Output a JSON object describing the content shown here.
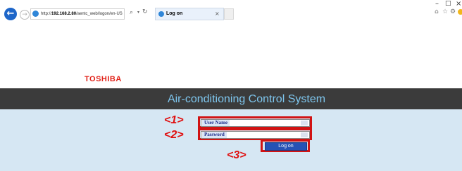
{
  "browser": {
    "url_prefix": "http://",
    "url_host": "192.168.2.80",
    "url_path": "/aentc_web/logon/en-US",
    "tab_title": "Log on",
    "tab_close": "×",
    "back_glyph": "←",
    "forward_glyph": "→",
    "window_min": "–",
    "window_max": "□",
    "window_close": "×",
    "search_glyph": "⌕",
    "dropdown_glyph": "▾",
    "refresh_glyph": "↻",
    "home_glyph": "⌂",
    "star_glyph": "☆",
    "gear_glyph": "⚙"
  },
  "page": {
    "logo": "TOSHIBA",
    "title": "Air-conditioning Control System"
  },
  "form": {
    "username_label": "User Name",
    "password_label": "Password",
    "username_value": "",
    "password_value": "",
    "login_label": "Log on"
  },
  "annotations": {
    "one": "<1>",
    "two": "<2>",
    "three": "<3>"
  },
  "colors": {
    "header_bg": "#3b3b3b",
    "title": "#7ec6ee",
    "form_bg": "#d6e7f3",
    "annotation": "#d11313",
    "button": "#2652b5",
    "logo": "#e2231a"
  }
}
